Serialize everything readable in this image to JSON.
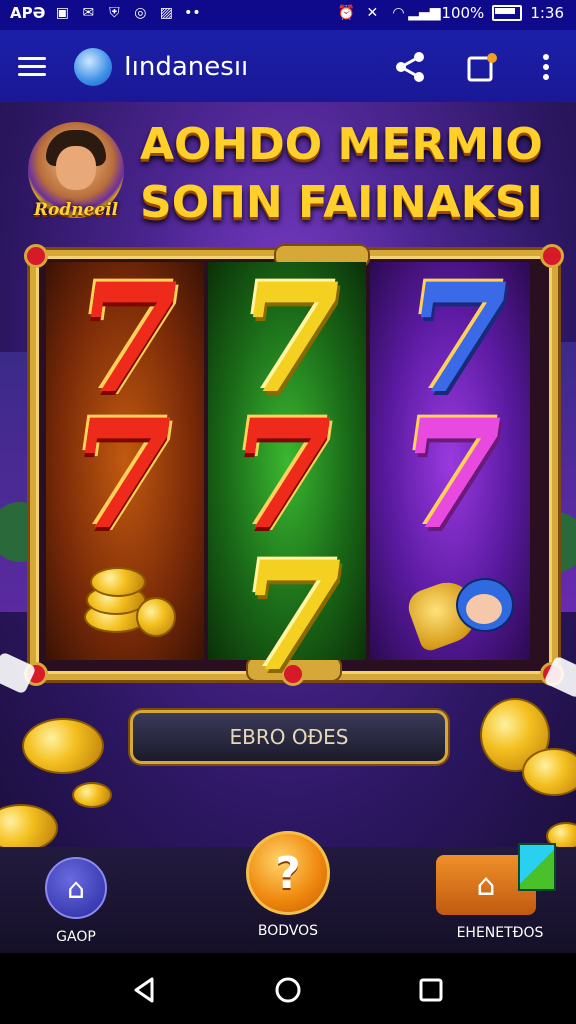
{
  "status_bar": {
    "carrier": "APƏ",
    "battery": "100%",
    "time": "1:36"
  },
  "app_bar": {
    "title": "Iındanesıı"
  },
  "banner": {
    "avatar_label": "Rodneeil",
    "headline_line1": "AOHDO MERMIO",
    "headline_line2": "SOΠN FAIINAKSI"
  },
  "reels": {
    "symbols": [
      [
        "7",
        "7"
      ],
      [
        "7",
        "7",
        "7"
      ],
      [
        "7",
        "7"
      ]
    ]
  },
  "cta": {
    "label": "EBRO OĐES"
  },
  "bottom_nav": {
    "home": "GAOP",
    "bonus": "BODVOS",
    "events": "EHENETÐOS"
  },
  "colors": {
    "status_bar": "#0f0a8c",
    "app_bar": "#1b1fa8",
    "gold": "#d6a838",
    "headline": "#ffcf2a"
  },
  "icons": {
    "menu": "hamburger-icon",
    "share": "share-icon",
    "tabs": "tab-icon",
    "more": "more-vert-icon",
    "home": "home-icon",
    "bonus": "question-icon",
    "events": "gift-icon",
    "back": "back-triangle-icon",
    "home_sys": "home-circle-icon",
    "recents": "recents-square-icon"
  }
}
